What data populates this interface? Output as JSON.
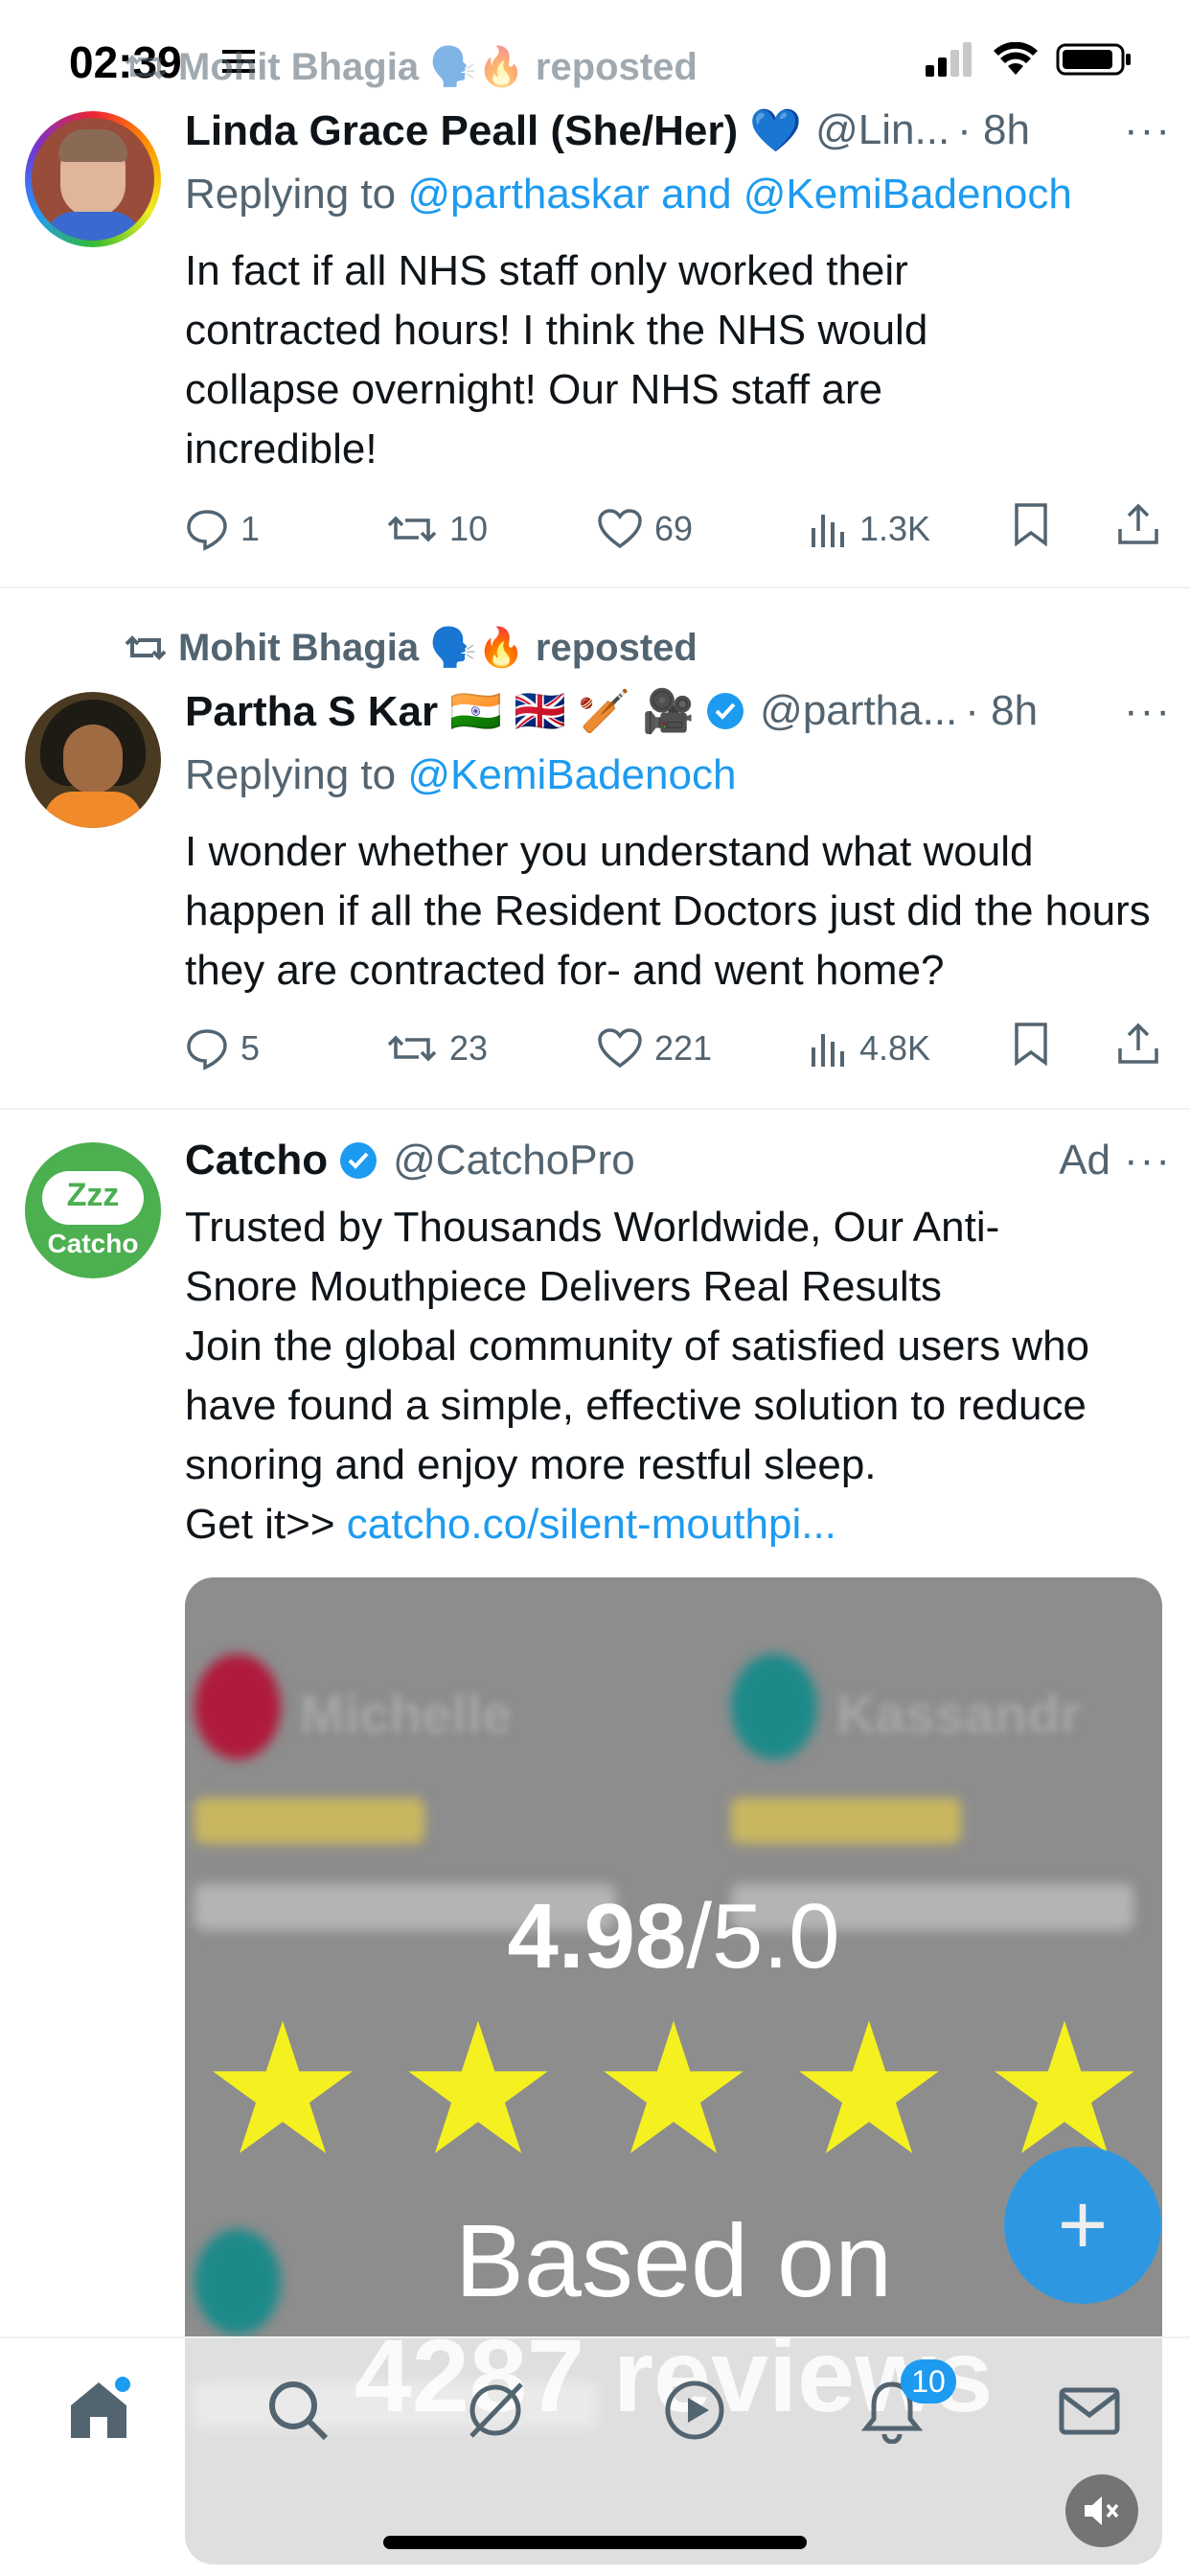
{
  "status_bar": {
    "time": "02:39"
  },
  "tweets": [
    {
      "repost_text": "Mohit Bhagia 🗣️🔥 reposted",
      "name": "Linda Grace Peall (She/Her) 💙",
      "handle": "@Lin...",
      "time": "· 8h",
      "reply_prefix": "Replying to ",
      "reply_mentions": "@parthaskar and @KemiBadenoch",
      "text": "In fact if all NHS staff only worked their contracted hours! I think the NHS would collapse overnight! Our NHS staff are incredible!",
      "replies": "1",
      "reposts": "10",
      "likes": "69",
      "views": "1.3K"
    },
    {
      "repost_text": "Mohit Bhagia 🗣️🔥 reposted",
      "name": "Partha S Kar 🇮🇳 🇬🇧 🏏 🎥",
      "handle": "@partha...",
      "time": "· 8h",
      "reply_prefix": "Replying to ",
      "reply_mentions": "@KemiBadenoch",
      "text": "I wonder whether you understand what would happen if all the Resident Doctors just did the hours they are contracted for- and went home?",
      "replies": "5",
      "reposts": "23",
      "likes": "221",
      "views": "4.8K"
    }
  ],
  "ad": {
    "name": "Catcho",
    "handle": "@CatchoPro",
    "ad_label": "Ad",
    "avatar_top": "Zzz",
    "avatar_bottom": "Catcho",
    "text_line1": "Trusted by Thousands Worldwide, Our Anti-Snore Mouthpiece Delivers Real Results",
    "text_line2": "Join the global community of satisfied users who have found a simple, effective solution to reduce snoring and enjoy more restful sleep.",
    "get_it": "Get it>> ",
    "link": "catcho.co/silent-mouthpi...",
    "image_rating_big": "4.98",
    "image_rating_small": "/5.0",
    "image_based": "Based on",
    "image_reviews": "4287 reviews",
    "image_names": [
      "Michelle",
      "Kassandr"
    ]
  },
  "nav": {
    "notification_count": "10"
  },
  "colors": {
    "accent": "#1d9bf0",
    "secondary_text": "#536471"
  }
}
